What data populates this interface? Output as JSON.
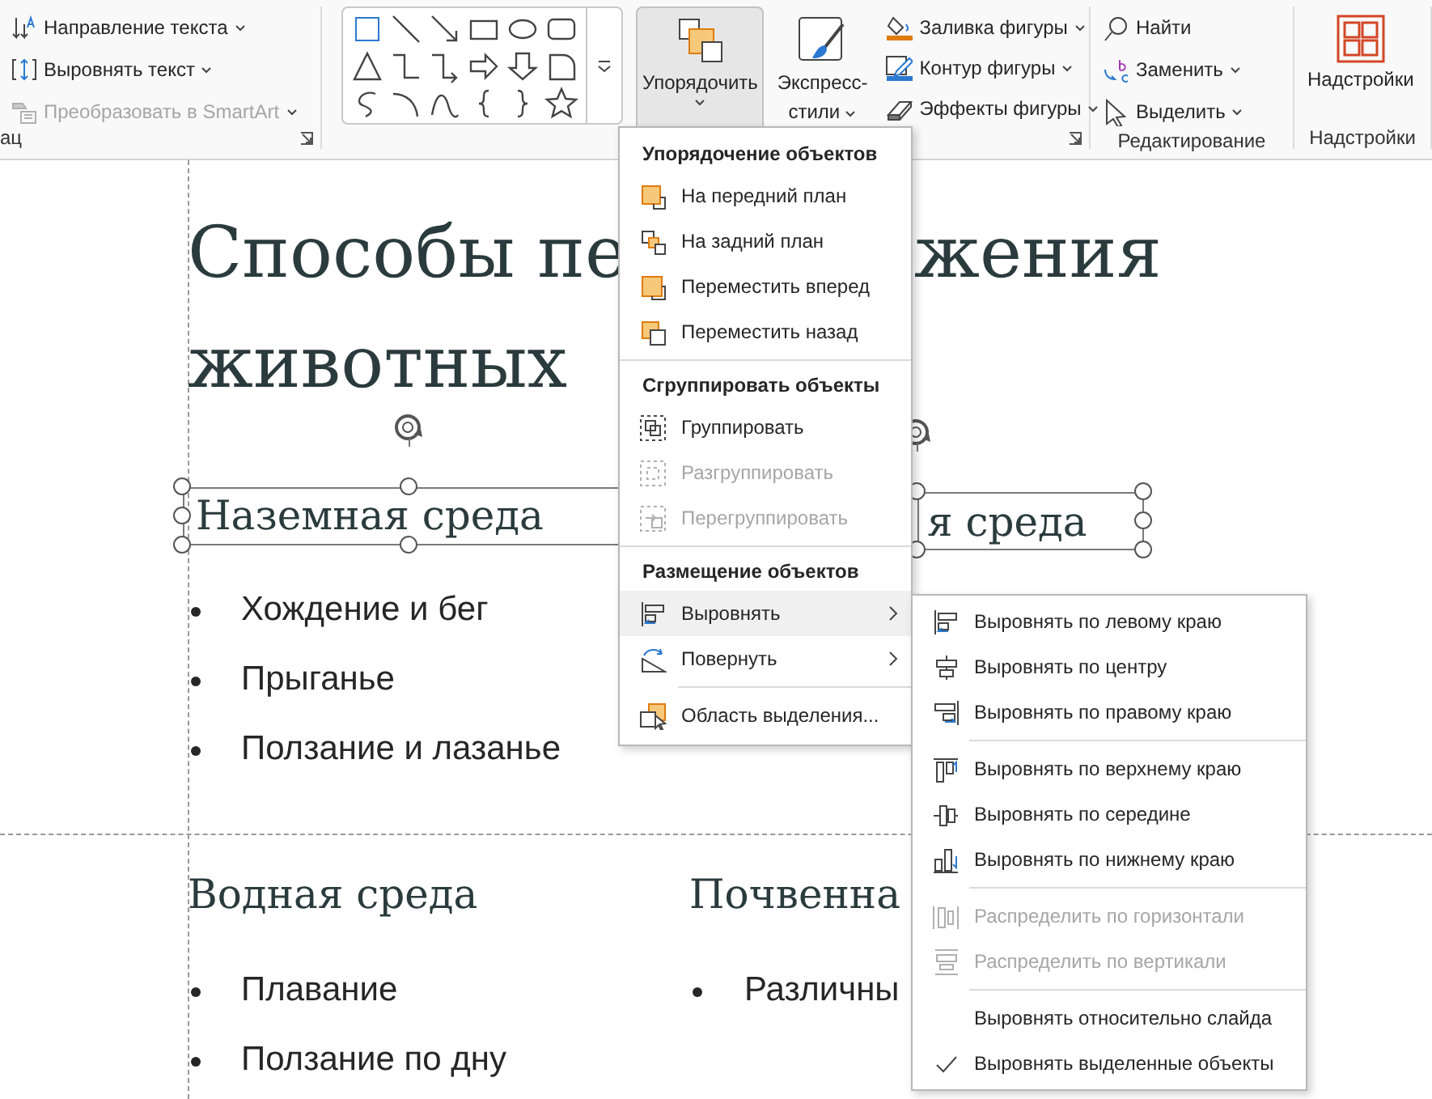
{
  "ribbon": {
    "text_group": {
      "items": [
        {
          "label": "Направление текста",
          "disabled": false
        },
        {
          "label": "Выровнять текст",
          "disabled": false
        },
        {
          "label": "Преобразовать в SmartArt",
          "disabled": true
        }
      ],
      "label": "ац"
    },
    "arrange_button": {
      "label": "Упорядочить",
      "pressed": true
    },
    "quick_styles_button": {
      "label_lines": [
        "Экспресс-",
        "стили"
      ]
    },
    "shape_format": [
      {
        "label": "Заливка фигуры"
      },
      {
        "label": "Контур фигуры"
      },
      {
        "label": "Эффекты фигуры"
      }
    ],
    "editing_group": {
      "items": [
        {
          "label": "Найти",
          "dropdown": false
        },
        {
          "label": "Заменить",
          "dropdown": true
        },
        {
          "label": "Выделить",
          "dropdown": true
        }
      ],
      "label": "Редактирование"
    },
    "addins_group": {
      "button": "Надстройки",
      "label": "Надстройки"
    }
  },
  "slide": {
    "title_fragments": [
      "Способы пе",
      "жения",
      "животных"
    ],
    "sections": [
      {
        "heading": "Наземная среда",
        "selected": true,
        "bullets": [
          "Хождение и бег",
          "Прыганье",
          "Ползание и лазанье"
        ]
      },
      {
        "heading": "я среда",
        "selected": true
      },
      {
        "heading": "Водная среда",
        "selected": false,
        "bullets": [
          "Плавание",
          "Ползание по дну"
        ]
      },
      {
        "heading": "Почвенна",
        "selected": false,
        "bullets": [
          "Различны"
        ]
      }
    ]
  },
  "arrange_menu": {
    "sections": [
      {
        "header": "Упорядочение объектов",
        "items": [
          {
            "label": "На передний план",
            "disabled": false,
            "submenu": false,
            "highlighted": false
          },
          {
            "label": "На задний план",
            "disabled": false,
            "submenu": false,
            "highlighted": false
          },
          {
            "label": "Переместить вперед",
            "disabled": false,
            "submenu": false,
            "highlighted": false
          },
          {
            "label": "Переместить назад",
            "disabled": false,
            "submenu": false,
            "highlighted": false
          }
        ]
      },
      {
        "header": "Сгруппировать объекты",
        "items": [
          {
            "label": "Группировать",
            "disabled": false,
            "submenu": false,
            "highlighted": false
          },
          {
            "label": "Разгруппировать",
            "disabled": true,
            "submenu": false,
            "highlighted": false
          },
          {
            "label": "Перегруппировать",
            "disabled": true,
            "submenu": false,
            "highlighted": false
          }
        ]
      },
      {
        "header": "Размещение объектов",
        "items": [
          {
            "label": "Выровнять",
            "disabled": false,
            "submenu": true,
            "highlighted": true
          },
          {
            "label": "Повернуть",
            "disabled": false,
            "submenu": true,
            "highlighted": false
          },
          {
            "label": "Область выделения...",
            "disabled": false,
            "submenu": false,
            "highlighted": false
          }
        ]
      }
    ]
  },
  "align_submenu": {
    "groups": [
      {
        "items": [
          {
            "label": "Выровнять по левому краю",
            "disabled": false
          },
          {
            "label": "Выровнять по центру",
            "disabled": false
          },
          {
            "label": "Выровнять по правому краю",
            "disabled": false
          }
        ]
      },
      {
        "items": [
          {
            "label": "Выровнять по верхнему краю",
            "disabled": false
          },
          {
            "label": "Выровнять по середине",
            "disabled": false
          },
          {
            "label": "Выровнять по нижнему краю",
            "disabled": false
          }
        ]
      },
      {
        "items": [
          {
            "label": "Распределить по горизонтали",
            "disabled": true
          },
          {
            "label": "Распределить по вертикали",
            "disabled": true
          }
        ]
      },
      {
        "items": [
          {
            "label": "Выровнять относительно слайда",
            "disabled": false,
            "checked": false
          },
          {
            "label": "Выровнять выделенные объекты",
            "disabled": false,
            "checked": true
          }
        ]
      }
    ]
  }
}
